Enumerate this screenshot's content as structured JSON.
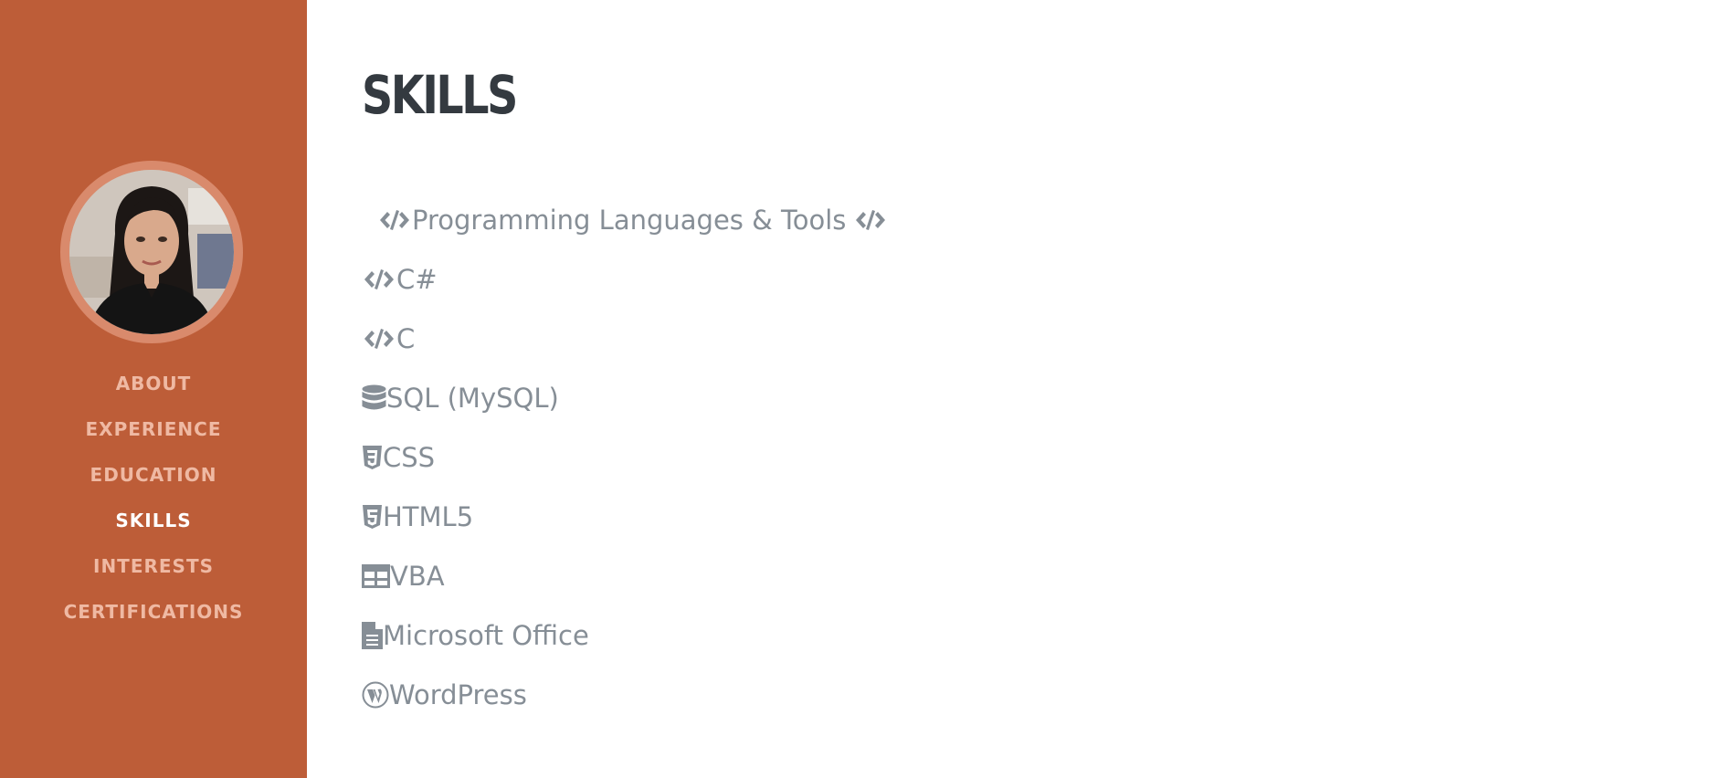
{
  "sidebar": {
    "nav": [
      {
        "label": "ABOUT"
      },
      {
        "label": "EXPERIENCE"
      },
      {
        "label": "EDUCATION"
      },
      {
        "label": "SKILLS"
      },
      {
        "label": "INTERESTS"
      },
      {
        "label": "CERTIFICATIONS"
      }
    ],
    "active_item": "SKILLS",
    "brand_color": "#bd5d38"
  },
  "main": {
    "title": "SKILLS",
    "skills_header": "Programming Languages & Tools",
    "skills": [
      {
        "label": "C#",
        "icon": "code-icon"
      },
      {
        "label": "C",
        "icon": "code-icon"
      },
      {
        "label": "SQL (MySQL)",
        "icon": "database-icon"
      },
      {
        "label": "CSS",
        "icon": "css3-icon"
      },
      {
        "label": "HTML5",
        "icon": "html5-icon"
      },
      {
        "label": "VBA",
        "icon": "table-icon"
      },
      {
        "label": "Microsoft Office",
        "icon": "document-icon"
      },
      {
        "label": "WordPress",
        "icon": "wordpress-icon"
      }
    ]
  }
}
